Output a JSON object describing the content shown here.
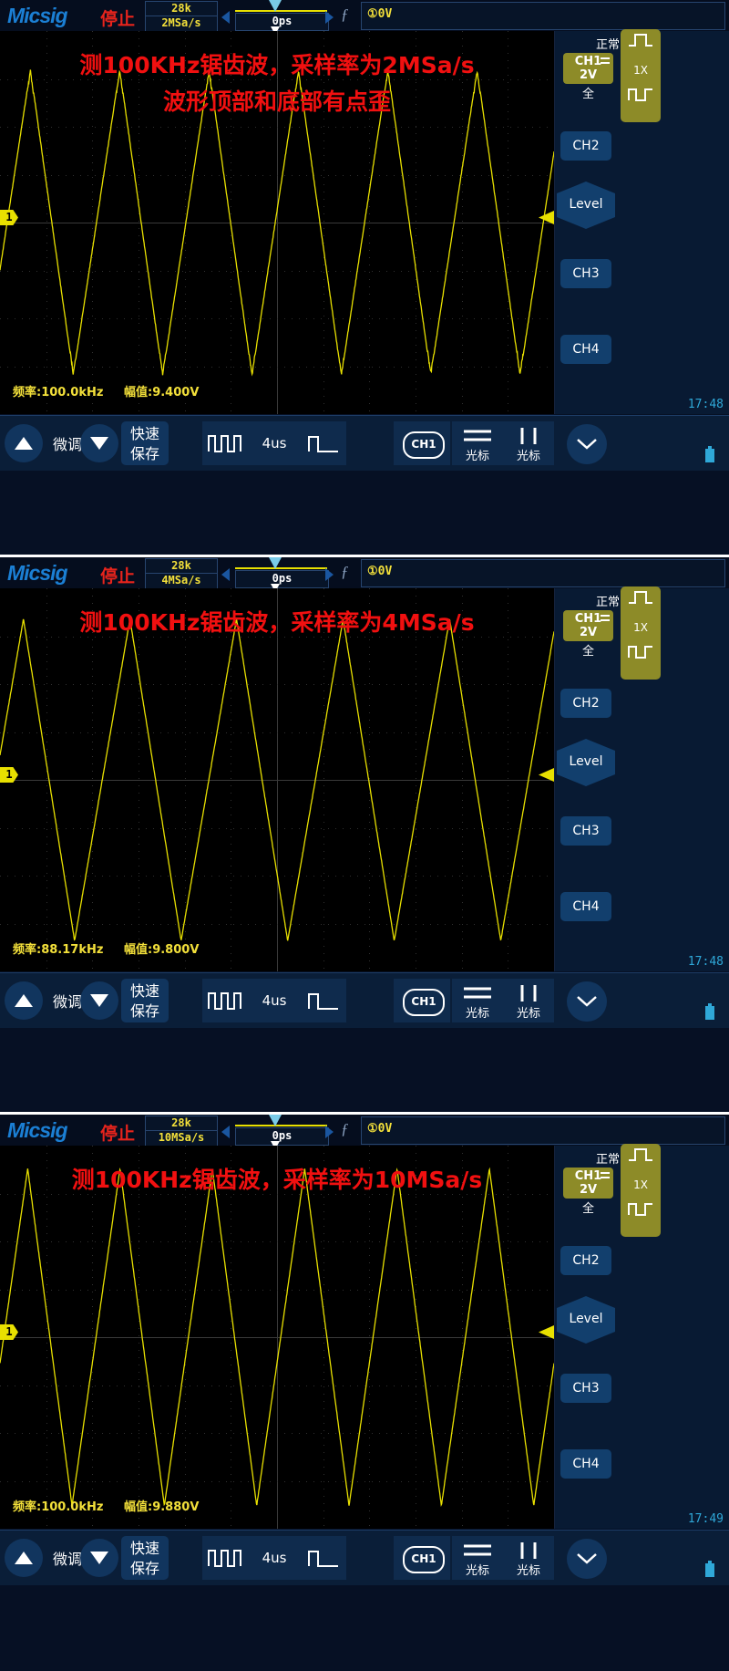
{
  "brand": "Micsig",
  "panels": [
    {
      "header": {
        "run_state": "停止",
        "mem_depth": "28k",
        "sample_rate": "2MSa/s",
        "time_offset": "0ps",
        "trigger_info": "①0V"
      },
      "annotations": [
        "测100KHz锯齿波，采样率为2MSa/s",
        "波形顶部和底部有点歪"
      ],
      "measurements": {
        "freq": "频率:100.0kHz",
        "ampl": "幅值:9.400V"
      },
      "sidebar": {
        "trigger_mode": "正常",
        "ch1_label": "CH1",
        "ch1_scale": "2V",
        "coupling": "全",
        "probe": "1X",
        "ch2": "CH2",
        "level": "Level",
        "ch3": "CH3",
        "ch4": "CH4"
      },
      "toolbar": {
        "fine_label": "微调",
        "quick_save": "快速\n保存",
        "timebase": "4us",
        "channel_chip": "CH1",
        "cursor_h": "光标",
        "cursor_v": "光标",
        "clock": "17:48"
      },
      "wave": {
        "cycles": 6.2,
        "phase": 0.18,
        "amp_frac": 0.4,
        "jitter": true
      }
    },
    {
      "header": {
        "run_state": "停止",
        "mem_depth": "28k",
        "sample_rate": "4MSa/s",
        "time_offset": "0ps",
        "trigger_info": "①0V"
      },
      "annotations": [
        "测100KHz锯齿波，采样率为4MSa/s"
      ],
      "measurements": {
        "freq": "频率:88.17kHz",
        "ampl": "幅值:9.800V"
      },
      "sidebar": {
        "trigger_mode": "正常",
        "ch1_label": "CH1",
        "ch1_scale": "2V",
        "coupling": "全",
        "probe": "1X",
        "ch2": "CH2",
        "level": "Level",
        "ch3": "CH3",
        "ch4": "CH4"
      },
      "toolbar": {
        "fine_label": "微调",
        "quick_save": "快速\n保存",
        "timebase": "4us",
        "channel_chip": "CH1",
        "cursor_h": "光标",
        "cursor_v": "光标",
        "clock": "17:48"
      },
      "wave": {
        "cycles": 5.2,
        "phase": 0.3,
        "amp_frac": 0.42,
        "jitter": false
      }
    },
    {
      "header": {
        "run_state": "停止",
        "mem_depth": "28k",
        "sample_rate": "10MSa/s",
        "time_offset": "0ps",
        "trigger_info": "①0V"
      },
      "annotations": [
        "测100KHz锯齿波，采样率为10MSa/s"
      ],
      "measurements": {
        "freq": "频率:100.0kHz",
        "ampl": "幅值:9.880V"
      },
      "sidebar": {
        "trigger_mode": "正常",
        "ch1_label": "CH1",
        "ch1_scale": "2V",
        "coupling": "全",
        "probe": "1X",
        "ch2": "CH2",
        "level": "Level",
        "ch3": "CH3",
        "ch4": "CH4"
      },
      "toolbar": {
        "fine_label": "微调",
        "quick_save": "快速\n保存",
        "timebase": "4us",
        "channel_chip": "CH1",
        "cursor_h": "光标",
        "cursor_v": "光标",
        "clock": "17:49"
      },
      "wave": {
        "cycles": 6.0,
        "phase": 0.22,
        "amp_frac": 0.44,
        "jitter": false
      }
    }
  ],
  "colors": {
    "brand_blue": "#1b7fd4",
    "trace_yellow": "#e8e000",
    "annotation_red": "#f11010",
    "accent_olive": "#8d8b28",
    "panel_blue": "#081a33",
    "button_blue": "#123f6d"
  }
}
